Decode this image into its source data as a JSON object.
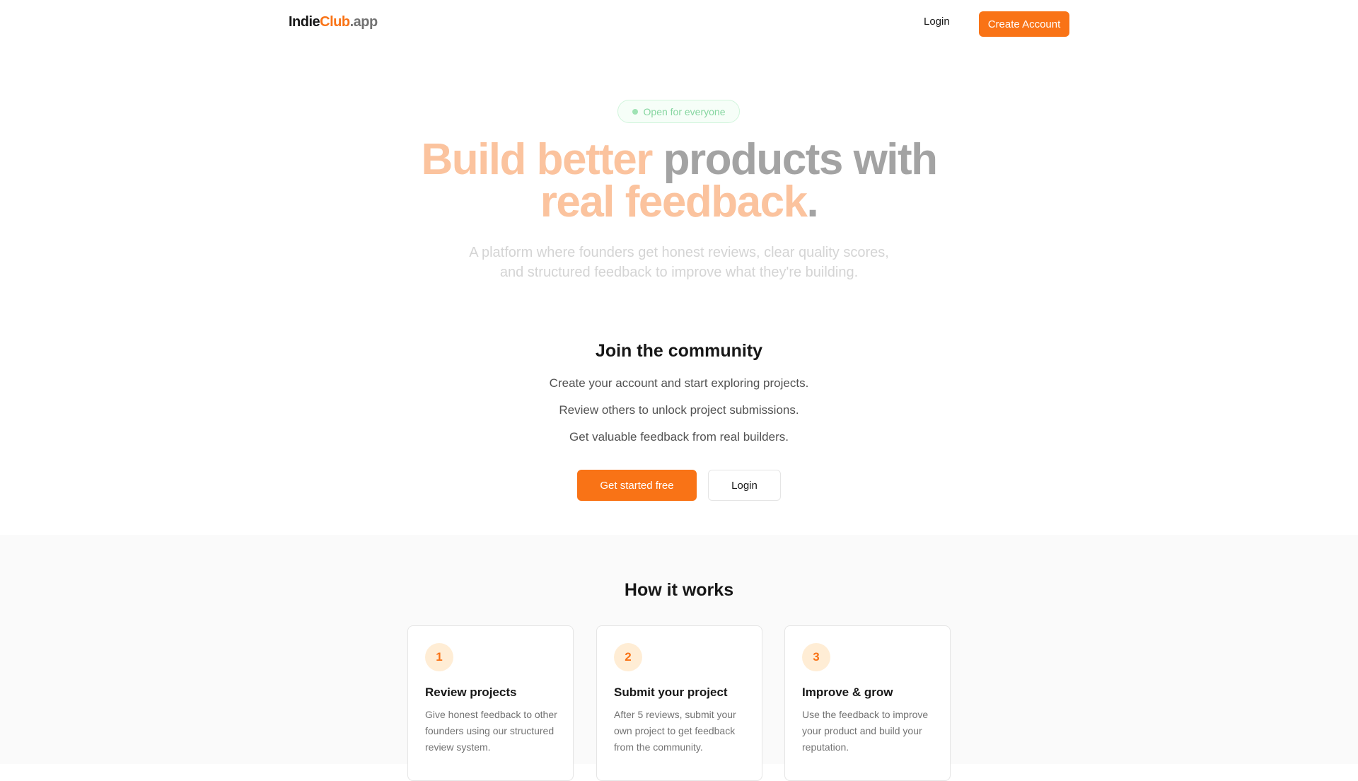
{
  "header": {
    "logo": {
      "part1": "Indie",
      "part2": "Club",
      "part3": ".app"
    },
    "login_label": "Login",
    "create_account_label": "Create Account"
  },
  "hero": {
    "badge": "Open for everyone",
    "title": {
      "accent1": "Build better",
      "muted1": "products with",
      "accent2": "real feedback",
      "muted2": "."
    },
    "subtitle_line1": "A platform where founders get honest reviews, clear quality scores,",
    "subtitle_line2": "and structured feedback to improve what they're building."
  },
  "community": {
    "title": "Join the community",
    "lines": [
      "Create your account and start exploring projects.",
      "Review others to unlock project submissions.",
      "Get valuable feedback from real builders."
    ],
    "primary_cta": "Get started free",
    "secondary_cta": "Login"
  },
  "how_it_works": {
    "title": "How it works",
    "steps": [
      {
        "number": "1",
        "title": "Review projects",
        "description": "Give honest feedback to other founders using our structured review system."
      },
      {
        "number": "2",
        "title": "Submit your project",
        "description": "After 5 reviews, submit your own project to get feedback from the community."
      },
      {
        "number": "3",
        "title": "Improve & grow",
        "description": "Use the feedback to improve your product and build your reputation."
      }
    ]
  },
  "colors": {
    "brand_orange": "#f97316",
    "accent_light": "#fbc39e",
    "badge_green": "#86d6a0"
  }
}
